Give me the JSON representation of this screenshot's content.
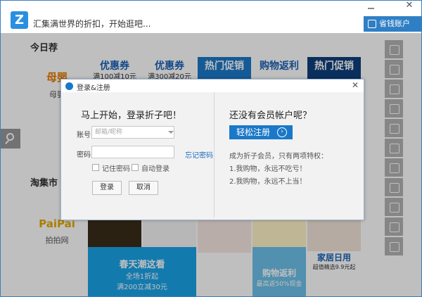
{
  "window": {
    "title": "汇集满世界的折扣，开始逛吧...",
    "logo_char": "Z",
    "wallet_label": "省钱账户",
    "close_glyph": "✕"
  },
  "sections": {
    "today": "今日荐",
    "market": "淘集市"
  },
  "shops": [
    {
      "logo": "母婴",
      "name": "母婴"
    },
    {
      "logo": "PaiPai",
      "name": "拍拍网"
    }
  ],
  "tiles": [
    {
      "big": "优惠券",
      "small": "满100减10元"
    },
    {
      "big": "优惠券",
      "small": "满300减20元"
    },
    {
      "big": "热门促销",
      "small": ""
    },
    {
      "big": "购物返利",
      "small": ""
    },
    {
      "big": "热门促销",
      "small": ""
    }
  ],
  "banners": [
    {
      "title": "春天潮这看",
      "line1": "全场1折起",
      "line2": "满200立减30元"
    },
    {
      "title": "购物返利",
      "line1": "最高返50%现金",
      "line2": ""
    },
    {
      "title": "家居日用",
      "line1": "超值精选9.9元起",
      "line2": ""
    }
  ],
  "dialog": {
    "title": "登录&注册",
    "close_glyph": "✕",
    "login": {
      "heading": "马上开始，登录折子吧！",
      "account_label": "账号：",
      "account_placeholder": "邮箱/昵称",
      "password_label": "密码：",
      "forgot_label": "忘记密码",
      "remember_label": "记住密码",
      "auto_label": "自动登录",
      "login_btn": "登录",
      "cancel_btn": "取消"
    },
    "register": {
      "heading": "还没有会员帐户呢？",
      "btn_label": "轻松注册",
      "intro": "成为折子会员，只有两项特权：",
      "perk1": "1.我购物，永远不吃亏！",
      "perk2": "2.我购物，永远不上当！"
    }
  },
  "colors": {
    "accent": "#1b78c8",
    "dark": "#0e3f7c"
  }
}
